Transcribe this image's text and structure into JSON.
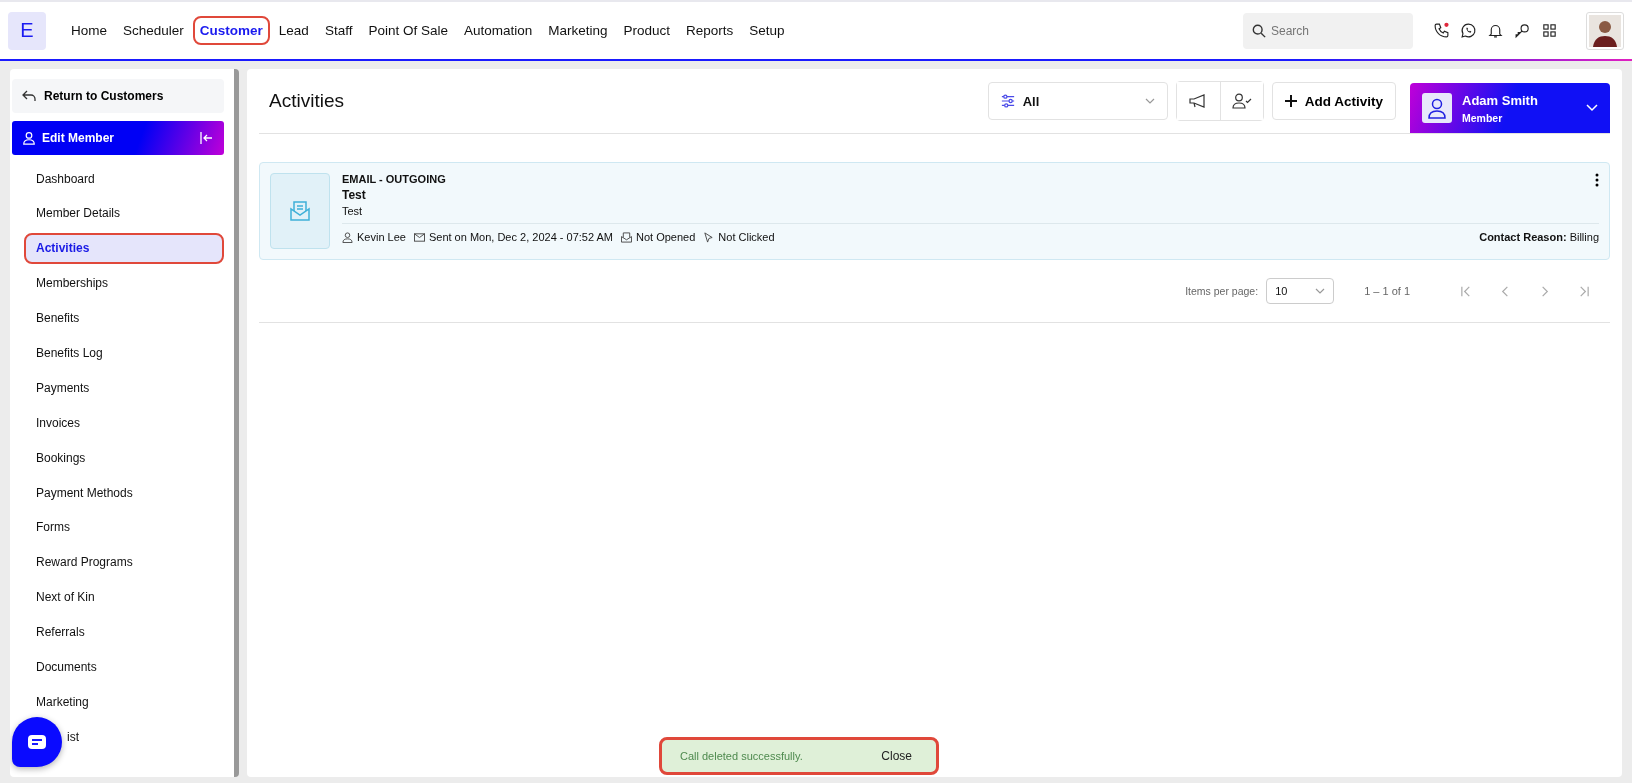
{
  "logo": "E",
  "nav": [
    {
      "label": "Home",
      "selected": false,
      "annotated": false
    },
    {
      "label": "Scheduler",
      "selected": false,
      "annotated": false
    },
    {
      "label": "Customer",
      "selected": true,
      "annotated": true
    },
    {
      "label": "Lead",
      "selected": false,
      "annotated": false
    },
    {
      "label": "Staff",
      "selected": false,
      "annotated": false
    },
    {
      "label": "Point Of Sale",
      "selected": false,
      "annotated": false
    },
    {
      "label": "Automation",
      "selected": false,
      "annotated": false
    },
    {
      "label": "Marketing",
      "selected": false,
      "annotated": false
    },
    {
      "label": "Product",
      "selected": false,
      "annotated": false
    },
    {
      "label": "Reports",
      "selected": false,
      "annotated": false
    },
    {
      "label": "Setup",
      "selected": false,
      "annotated": false
    }
  ],
  "search": {
    "placeholder": "Search"
  },
  "sidebar": {
    "back": "Return to Customers",
    "section": "Edit Member",
    "items": [
      {
        "label": "Dashboard",
        "selected": false,
        "annotated": false
      },
      {
        "label": "Member Details",
        "selected": false,
        "annotated": false
      },
      {
        "label": "Activities",
        "selected": true,
        "annotated": true
      },
      {
        "label": "Memberships",
        "selected": false,
        "annotated": false
      },
      {
        "label": "Benefits",
        "selected": false,
        "annotated": false
      },
      {
        "label": "Benefits Log",
        "selected": false,
        "annotated": false
      },
      {
        "label": "Payments",
        "selected": false,
        "annotated": false
      },
      {
        "label": "Invoices",
        "selected": false,
        "annotated": false
      },
      {
        "label": "Bookings",
        "selected": false,
        "annotated": false
      },
      {
        "label": "Payment Methods",
        "selected": false,
        "annotated": false
      },
      {
        "label": "Forms",
        "selected": false,
        "annotated": false
      },
      {
        "label": "Reward Programs",
        "selected": false,
        "annotated": false
      },
      {
        "label": "Next of Kin",
        "selected": false,
        "annotated": false
      },
      {
        "label": "Referrals",
        "selected": false,
        "annotated": false
      },
      {
        "label": "Documents",
        "selected": false,
        "annotated": false
      },
      {
        "label": "Marketing",
        "selected": false,
        "annotated": false
      },
      {
        "label": "ist",
        "selected": false,
        "annotated": false
      }
    ]
  },
  "page": {
    "title": "Activities",
    "filter": "All",
    "add_button": "Add Activity",
    "member": {
      "name": "Adam Smith",
      "role": "Member"
    }
  },
  "activities": [
    {
      "type": "EMAIL - OUTGOING",
      "subject": "Test",
      "body": "Test",
      "staff": "Kevin Lee",
      "sent": "Sent on Mon, Dec 2, 2024 - 07:52 AM",
      "opened": "Not Opened",
      "clicked": "Not Clicked",
      "reason_label": "Contact Reason:",
      "reason": "Billing"
    }
  ],
  "pagination": {
    "label": "Items per page:",
    "per_page": "10",
    "range": "1 – 1 of 1"
  },
  "toast": {
    "message": "Call deleted successfully.",
    "action": "Close",
    "annotated": true
  }
}
